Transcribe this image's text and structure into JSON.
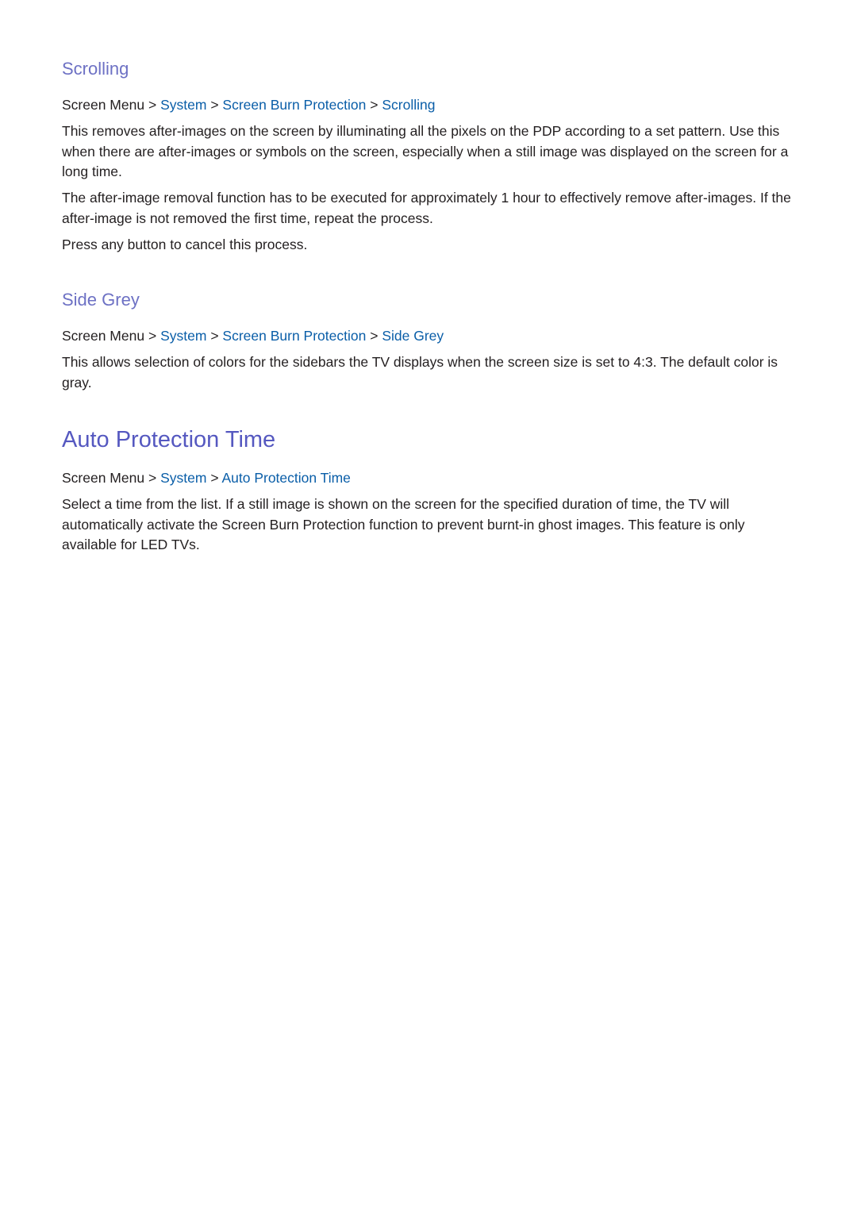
{
  "sections": [
    {
      "heading": "Scrolling",
      "path": {
        "root": "Screen Menu",
        "sep": ">",
        "items": [
          "System",
          "Screen Burn Protection",
          "Scrolling"
        ]
      },
      "paragraphs": [
        "This removes after-images on the screen by illuminating all the pixels on the PDP according to a set pattern. Use this when there are after-images or symbols on the screen, especially when a still image was displayed on the screen for a long time.",
        "The after-image removal function has to be executed for approximately 1 hour to effectively remove after-images. If the after-image is not removed the first time, repeat the process.",
        "Press any button to cancel this process."
      ]
    },
    {
      "heading": "Side Grey",
      "path": {
        "root": "Screen Menu",
        "sep": ">",
        "items": [
          "System",
          "Screen Burn Protection",
          "Side Grey"
        ]
      },
      "paragraphs": [
        "This allows selection of colors for the sidebars the TV displays when the screen size is set to 4:3. The default color is gray."
      ]
    },
    {
      "heading": "Auto Protection Time",
      "path": {
        "root": "Screen Menu",
        "sep": ">",
        "items": [
          "System",
          "Auto Protection Time"
        ]
      },
      "paragraphs": [
        "Select a time from the list. If a still image is shown on the screen for the specified duration of time, the TV will automatically activate the Screen Burn Protection function to prevent burnt-in ghost images. This feature is only available for LED TVs."
      ]
    }
  ],
  "colors": {
    "subheading": "#6d71c4",
    "heading": "#5558c0",
    "link": "#0a5ea8",
    "text": "#231f20"
  }
}
